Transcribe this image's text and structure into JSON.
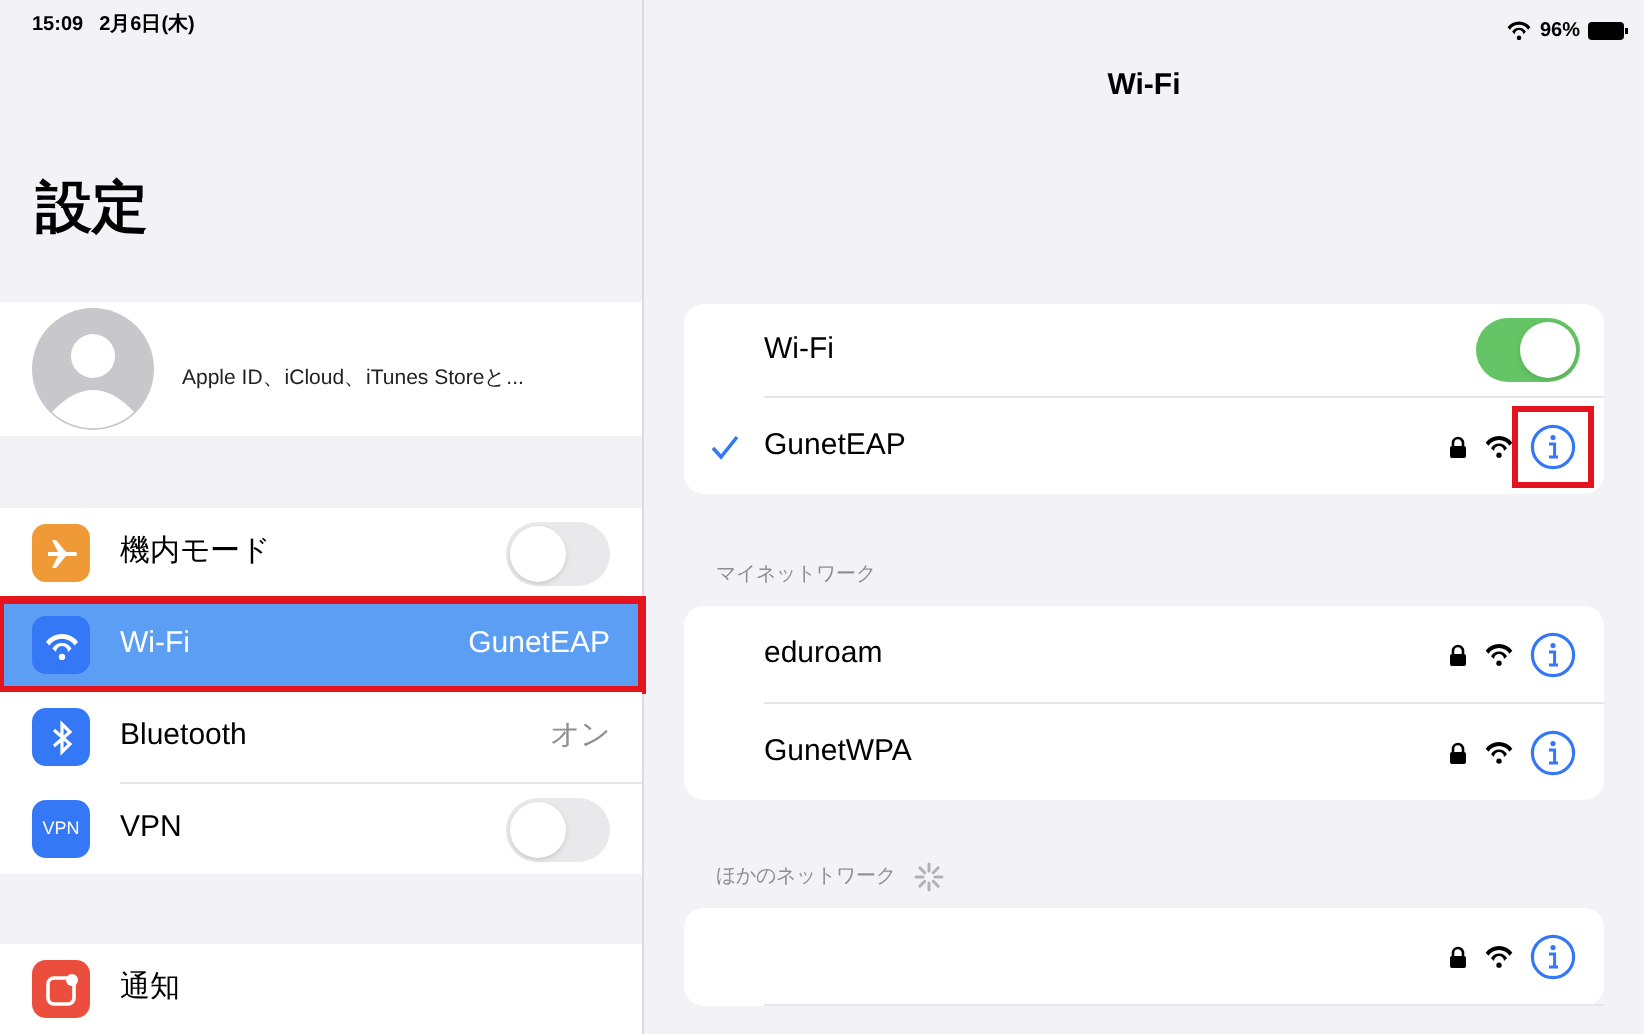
{
  "status_bar": {
    "time": "15:09",
    "date": "2月6日(木)",
    "battery": "96%"
  },
  "sidebar": {
    "title": "設定",
    "profile": {
      "subtitle": "Apple ID、iCloud、iTunes Storeと..."
    },
    "groups": [
      [
        {
          "kind": "toggle",
          "label": "機内モード",
          "color": "#f09a37",
          "on": false,
          "selected": false,
          "annotated": false
        },
        {
          "kind": "value",
          "label": "Wi-Fi",
          "color": "#3478f6",
          "value": "GunetEAP",
          "selected": true,
          "annotated": true
        },
        {
          "kind": "value",
          "label": "Bluetooth",
          "color": "#3478f6",
          "value": "オン",
          "selected": false,
          "annotated": false
        },
        {
          "kind": "toggle",
          "label": "VPN",
          "icon_text": "VPN",
          "color": "#3478f6",
          "on": false,
          "selected": false,
          "annotated": false
        }
      ],
      [
        {
          "kind": "plain",
          "label": "通知",
          "color": "#eb4e3d",
          "selected": false,
          "annotated": false
        }
      ]
    ]
  },
  "detail": {
    "title": "Wi-Fi",
    "wifi_card": {
      "label": "Wi-Fi",
      "on": true,
      "network": {
        "name": "GunetEAP",
        "locked": true,
        "connected": true,
        "annotated": true
      }
    },
    "sections": [
      {
        "header": "マイネットワーク",
        "loading": false,
        "networks": [
          {
            "name": "eduroam",
            "locked": true
          },
          {
            "name": "GunetWPA",
            "locked": true
          }
        ]
      },
      {
        "header": "ほかのネットワーク",
        "loading": true,
        "networks": [
          {
            "locked": true
          }
        ]
      }
    ]
  }
}
